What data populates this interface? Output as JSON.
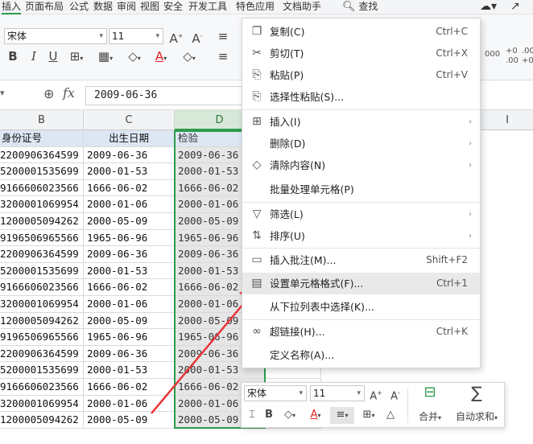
{
  "menu_tabs": [
    "插入",
    "页面布局",
    "公式",
    "数据",
    "审阅",
    "视图",
    "安全",
    "开发工具",
    "特色应用",
    "文档助手"
  ],
  "search_label": "查找",
  "ribbon": {
    "font_name": "宋体",
    "font_size": "11",
    "bold": "B",
    "italic": "I",
    "underline": "U",
    "font_color_glyph": "A"
  },
  "formula_bar": {
    "fx_label": "fx",
    "value": "2009-06-36"
  },
  "columns": [
    {
      "letter": "B"
    },
    {
      "letter": "C"
    },
    {
      "letter": "D"
    },
    {
      "letter": "I"
    }
  ],
  "table": {
    "headers": [
      "身份证号",
      "出生日期",
      "检验"
    ],
    "rows": [
      [
        "2200906364599",
        "2009-06-36",
        "2009-06-36"
      ],
      [
        "5200001535699",
        "2000-01-53",
        "2000-01-53"
      ],
      [
        "9166606023566",
        "1666-06-02",
        "1666-06-02"
      ],
      [
        "3200001069954",
        "2000-01-06",
        "2000-01-06"
      ],
      [
        "1200005094262",
        "2000-05-09",
        "2000-05-09"
      ],
      [
        "9196506965566",
        "1965-06-96",
        "1965-06-96"
      ],
      [
        "2200906364599",
        "2009-06-36",
        "2009-06-36"
      ],
      [
        "5200001535699",
        "2000-01-53",
        "2000-01-53"
      ],
      [
        "9166606023566",
        "1666-06-02",
        "1666-06-02"
      ],
      [
        "3200001069954",
        "2000-01-06",
        "2000-01-06"
      ],
      [
        "1200005094262",
        "2000-05-09",
        "2000-05-09"
      ],
      [
        "9196506965566",
        "1965-06-96",
        "1965-06-96"
      ],
      [
        "2200906364599",
        "2009-06-36",
        "2009-06-36"
      ],
      [
        "5200001535699",
        "2000-01-53",
        "2000-01-53"
      ],
      [
        "9166606023566",
        "1666-06-02",
        "1666-06-02"
      ],
      [
        "3200001069954",
        "2000-01-06",
        "2000-01-06"
      ],
      [
        "1200005094262",
        "2000-05-09",
        "2000-05-09"
      ]
    ]
  },
  "context_menu": {
    "items": [
      {
        "label": "复制(C)",
        "shortcut": "Ctrl+C",
        "icon": "copy-icon"
      },
      {
        "label": "剪切(T)",
        "shortcut": "Ctrl+X",
        "icon": "scissors-icon"
      },
      {
        "label": "粘贴(P)",
        "shortcut": "Ctrl+V",
        "icon": "paste-icon"
      },
      {
        "label": "选择性粘贴(S)...",
        "shortcut": "",
        "icon": "paste-special-icon"
      },
      {
        "label": "插入(I)",
        "shortcut": "",
        "icon": "insert-icon"
      },
      {
        "label": "删除(D)",
        "shortcut": "",
        "icon": ""
      },
      {
        "label": "清除内容(N)",
        "shortcut": "",
        "icon": "eraser-icon"
      },
      {
        "label": "批量处理单元格(P)",
        "shortcut": "",
        "icon": ""
      },
      {
        "label": "筛选(L)",
        "shortcut": "",
        "icon": "filter-icon"
      },
      {
        "label": "排序(U)",
        "shortcut": "",
        "icon": "sort-icon"
      },
      {
        "label": "插入批注(M)...",
        "shortcut": "Shift+F2",
        "icon": "comment-icon"
      },
      {
        "label": "设置单元格格式(F)...",
        "shortcut": "Ctrl+1",
        "icon": "format-cells-icon"
      },
      {
        "label": "从下拉列表中选择(K)...",
        "shortcut": "",
        "icon": ""
      },
      {
        "label": "超链接(H)...",
        "shortcut": "Ctrl+K",
        "icon": "link-icon"
      },
      {
        "label": "定义名称(A)...",
        "shortcut": "",
        "icon": ""
      }
    ]
  },
  "mini_toolbar": {
    "font_name": "宋体",
    "font_size": "11",
    "bold": "B",
    "merge_label": "合并",
    "autosum_label": "自动求和"
  },
  "colors": {
    "accent_green": "#2c9b4a",
    "annotation_red": "#e8343a",
    "header_fill": "#dde7f3",
    "checked_column_fill": "#e6e6e6"
  }
}
